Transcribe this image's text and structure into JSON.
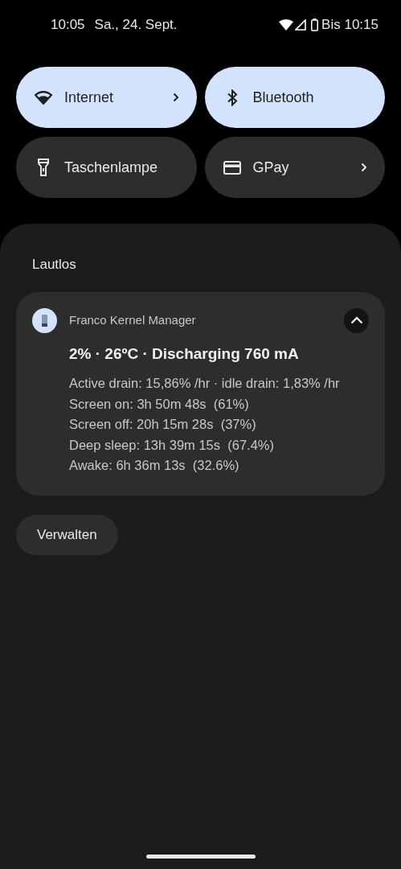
{
  "status_bar": {
    "time": "10:05",
    "date": "Sa., 24. Sept.",
    "battery_text": "Bis 10:15"
  },
  "tiles": [
    {
      "label": "Internet",
      "kind": "wifi",
      "on": true,
      "chevron": true
    },
    {
      "label": "Bluetooth",
      "kind": "bluetooth",
      "on": true,
      "chevron": false
    },
    {
      "label": "Taschenlampe",
      "kind": "flashlight",
      "on": false,
      "chevron": false
    },
    {
      "label": "GPay",
      "kind": "card",
      "on": false,
      "chevron": true
    }
  ],
  "section_title": "Lautlos",
  "notification": {
    "app": "Franco Kernel Manager",
    "expanded": true,
    "title": "2% · 26ºC · Discharging 760 mA",
    "lines": [
      "Active drain: 15,86% /hr · idle drain: 1,83% /hr",
      "Screen on: 3h 50m 48s  (61%)",
      "Screen off: 20h 15m 28s  (37%)",
      "Deep sleep: 13h 39m 15s  (67.4%)",
      "Awake: 6h 36m 13s  (32.6%)"
    ]
  },
  "manage_button": "Verwalten"
}
